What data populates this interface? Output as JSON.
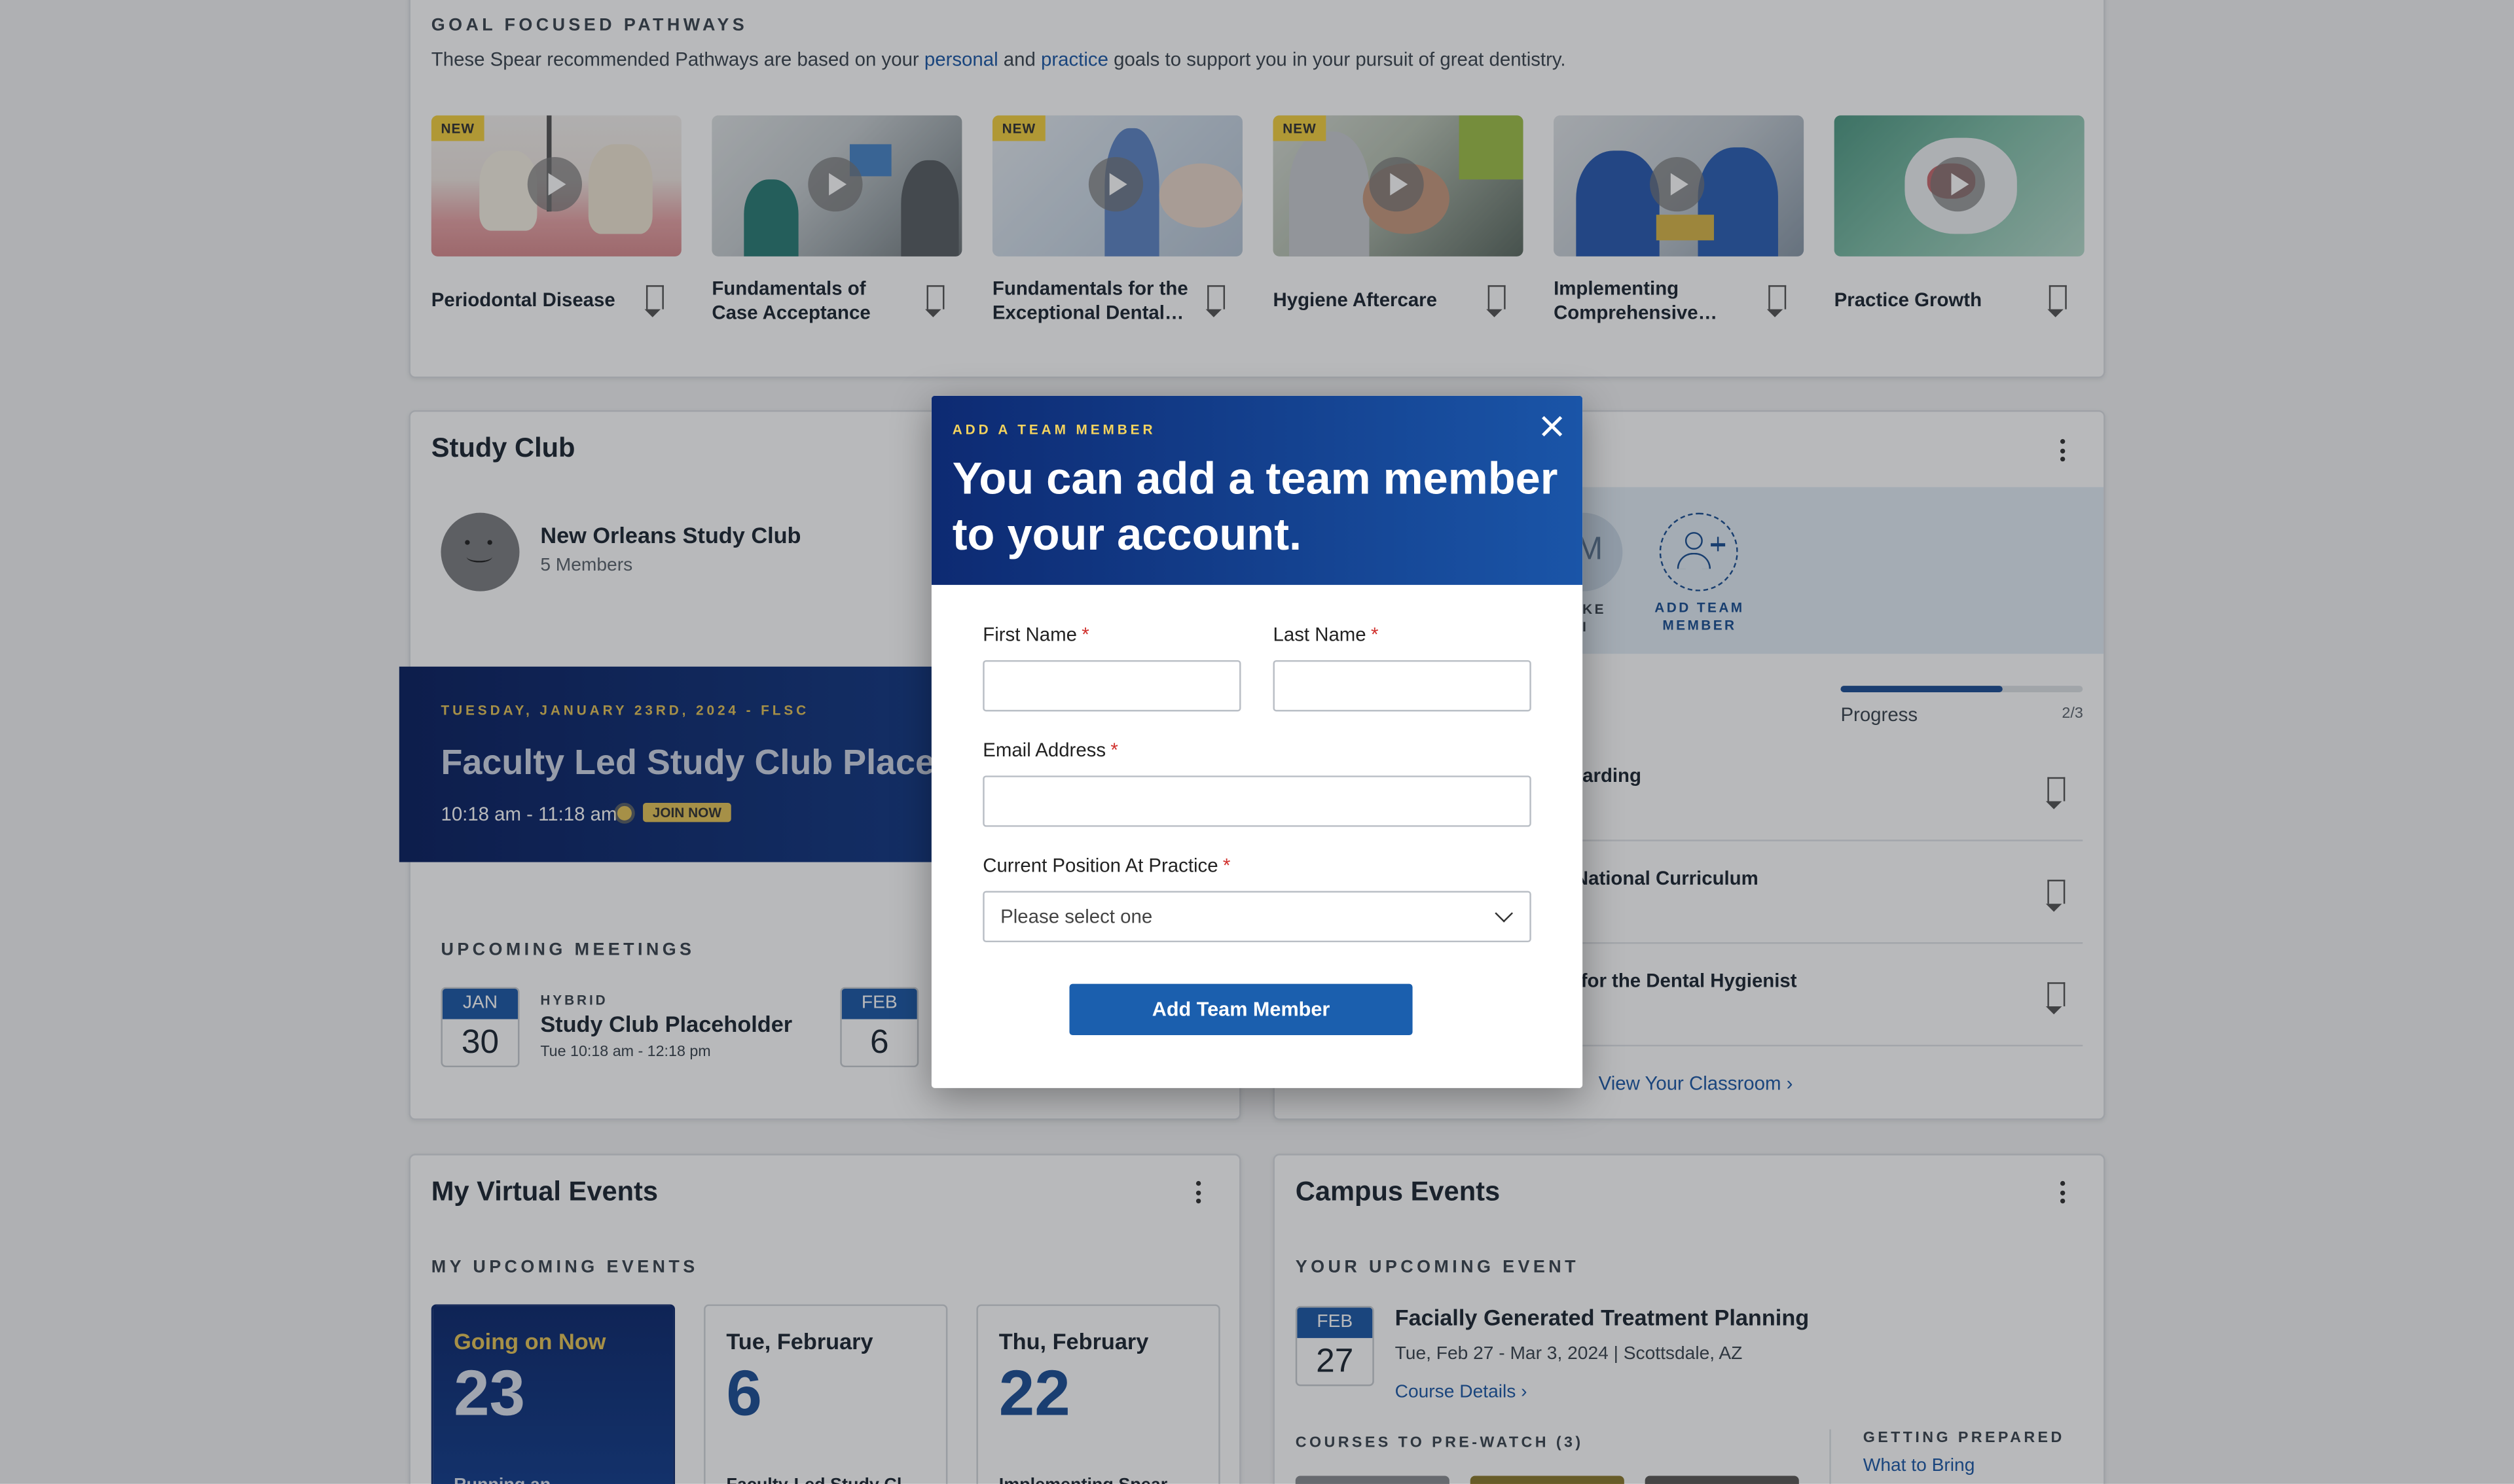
{
  "pathways": {
    "eyebrow": "GOAL FOCUSED PATHWAYS",
    "desc_pre": "These Spear recommended Pathways are based on your ",
    "desc_link1": "personal",
    "desc_mid": " and ",
    "desc_link2": "practice",
    "desc_post": " goals to support you in your pursuit of great dentistry.",
    "items": [
      {
        "title": "Periodontal Disease",
        "badge": "NEW"
      },
      {
        "title": "Fundamentals of Case Acceptance",
        "badge": ""
      },
      {
        "title": "Fundamentals for the Exceptional Dental…",
        "badge": "NEW"
      },
      {
        "title": "Hygiene Aftercare",
        "badge": "NEW"
      },
      {
        "title": "Implementing Comprehensive…",
        "badge": ""
      },
      {
        "title": "Practice Growth",
        "badge": ""
      }
    ]
  },
  "study_club": {
    "title": "Study Club",
    "club_name": "New Orleans Study Club",
    "members": "5 Members",
    "banner": {
      "date_line": "TUESDAY, JANUARY 23RD, 2024 - FLSC",
      "title": "Faculty Led Study Club Placeholder",
      "time": "10:18 am - 11:18 am",
      "join": "JOIN NOW"
    },
    "upcoming_label": "UPCOMING MEETINGS",
    "meetings": [
      {
        "month": "JAN",
        "day": "30",
        "type": "HYBRID",
        "title": "Study Club Placeholder",
        "time": "Tue 10:18 am - 12:18 pm"
      },
      {
        "month": "FEB",
        "day": "6"
      }
    ]
  },
  "team_panel": {
    "avatar_letter": "M",
    "avatar_caption_1": "KE",
    "avatar_caption_2": "I",
    "add_label_1": "ADD TEAM",
    "add_label_2": "MEMBER",
    "progress_label": "Progress",
    "progress_value": "2/3",
    "progress_fraction": 0.667,
    "items": [
      "arding",
      "National Curriculum",
      "for the Dental Hygienist"
    ],
    "view_link": "View Your Classroom ›"
  },
  "virtual_events": {
    "title": "My Virtual Events",
    "upcoming_label": "MY UPCOMING EVENTS",
    "events": [
      {
        "weekday": "Going on Now",
        "day": "23",
        "title": "Running an…"
      },
      {
        "weekday": "Tue, February",
        "day": "6",
        "title": "Faculty-Led Study Cl…"
      },
      {
        "weekday": "Thu, February",
        "day": "22",
        "title": "Implementing Spear…"
      }
    ]
  },
  "campus_events": {
    "title": "Campus Events",
    "upcoming_label": "YOUR UPCOMING EVENT",
    "event": {
      "month": "FEB",
      "day": "27",
      "title": "Facially Generated Treatment Planning",
      "dates": "Tue, Feb 27 - Mar 3, 2024 | Scottsdale, AZ",
      "details_link": "Course Details ›"
    },
    "prewatch_label": "COURSES TO PRE-WATCH (3)",
    "prepared_label": "GETTING PREPARED",
    "what_to_bring": "What to Bring"
  },
  "modal": {
    "kicker": "ADD A TEAM MEMBER",
    "title": "You can add a team member to your account.",
    "first_name_label": "First Name",
    "last_name_label": "Last Name",
    "email_label": "Email Address",
    "position_label": "Current Position At Practice",
    "position_placeholder": "Please select one",
    "required_mark": "*",
    "submit": "Add Team Member"
  },
  "colors": {
    "accent": "#1b5fae",
    "navy": "#0d2a72",
    "gold": "#f4d35e",
    "required": "#d0312d"
  }
}
